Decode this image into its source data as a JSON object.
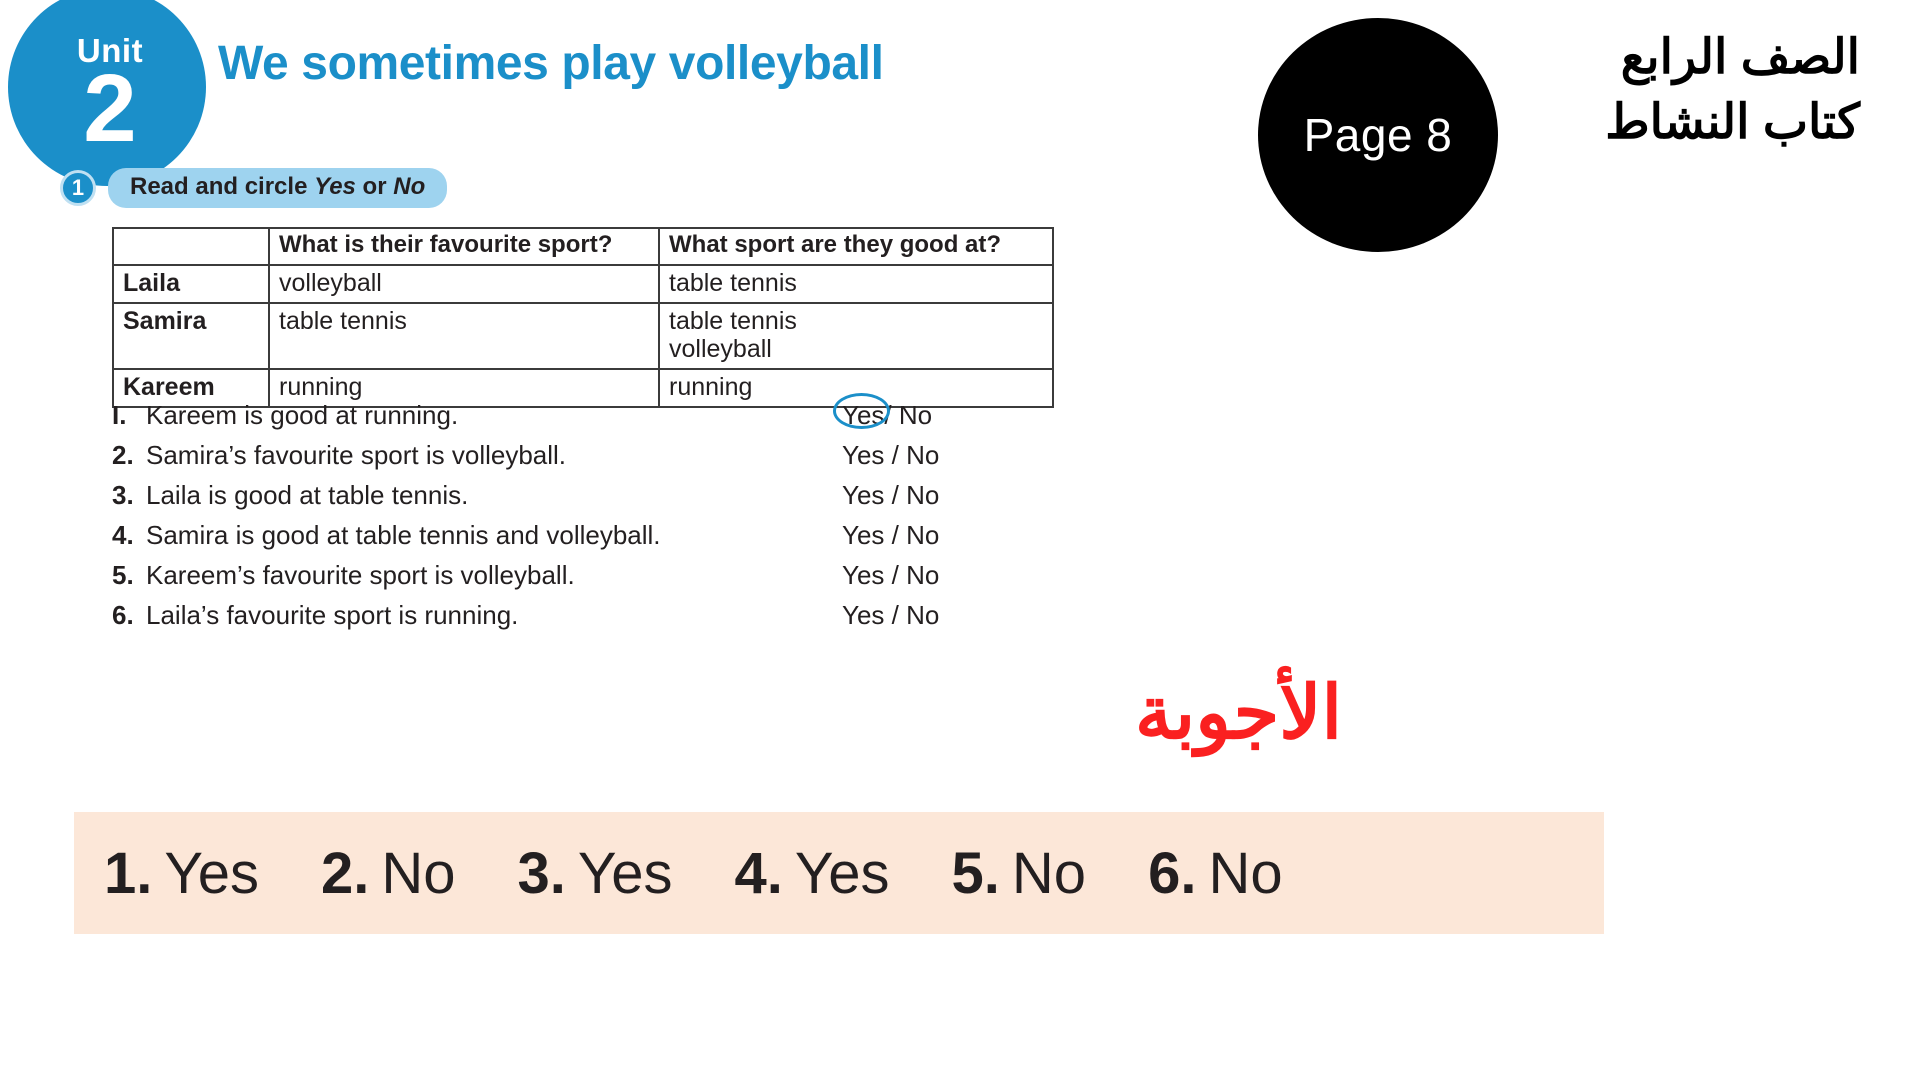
{
  "unit_badge": {
    "label": "Unit",
    "number": "2",
    "color": "#1b8fc9"
  },
  "lesson": {
    "title": "We sometimes play volleyball",
    "title_color": "#1b8fc9"
  },
  "exercise": {
    "number": "1",
    "instruction_prefix": "Read and circle ",
    "instruction_yes": "Yes",
    "instruction_middle": " or ",
    "instruction_no": "No",
    "pill_color": "#9ed3ef"
  },
  "table": {
    "headers": [
      "",
      "What is their favourite sport?",
      "What sport are they good at?"
    ],
    "rows": [
      {
        "name": "Laila",
        "favourite": "volleyball",
        "good_at": "table tennis"
      },
      {
        "name": "Samira",
        "favourite": "table tennis",
        "good_at": "table tennis\nvolleyball"
      },
      {
        "name": "Kareem",
        "favourite": "running",
        "good_at": "running"
      }
    ]
  },
  "questions": [
    {
      "num": "I.",
      "text": "Kareem is good at running.",
      "yes": "Yes",
      "sep": "/",
      "no": "No",
      "circled": "yes"
    },
    {
      "num": "2.",
      "text": "Samira’s favourite sport is volleyball.",
      "yes": "Yes",
      "sep": "/",
      "no": "No",
      "circled": ""
    },
    {
      "num": "3.",
      "text": "Laila is good at table tennis.",
      "yes": "Yes",
      "sep": "/",
      "no": "No",
      "circled": ""
    },
    {
      "num": "4.",
      "text": "Samira is good at table tennis and volleyball.",
      "yes": "Yes",
      "sep": "/",
      "no": "No",
      "circled": ""
    },
    {
      "num": "5.",
      "text": "Kareem’s favourite sport is volleyball.",
      "yes": "Yes",
      "sep": "/",
      "no": "No",
      "circled": ""
    },
    {
      "num": "6.",
      "text": "Laila’s favourite sport is running.",
      "yes": "Yes",
      "sep": "/",
      "no": "No",
      "circled": ""
    }
  ],
  "page_marker": {
    "label": "Page 8",
    "background": "#000000"
  },
  "arabic_meta": {
    "grade": "الصف الرابع",
    "book": "كتاب النشاط"
  },
  "answers_heading": {
    "text": "الأجوبة",
    "color": "#fa2020"
  },
  "answers_bar": {
    "background": "#fce7d8",
    "items": [
      {
        "num": "1.",
        "value": "Yes"
      },
      {
        "num": "2.",
        "value": "No"
      },
      {
        "num": "3.",
        "value": "Yes"
      },
      {
        "num": "4.",
        "value": "Yes"
      },
      {
        "num": "5.",
        "value": "No"
      },
      {
        "num": "6.",
        "value": "No"
      }
    ]
  }
}
